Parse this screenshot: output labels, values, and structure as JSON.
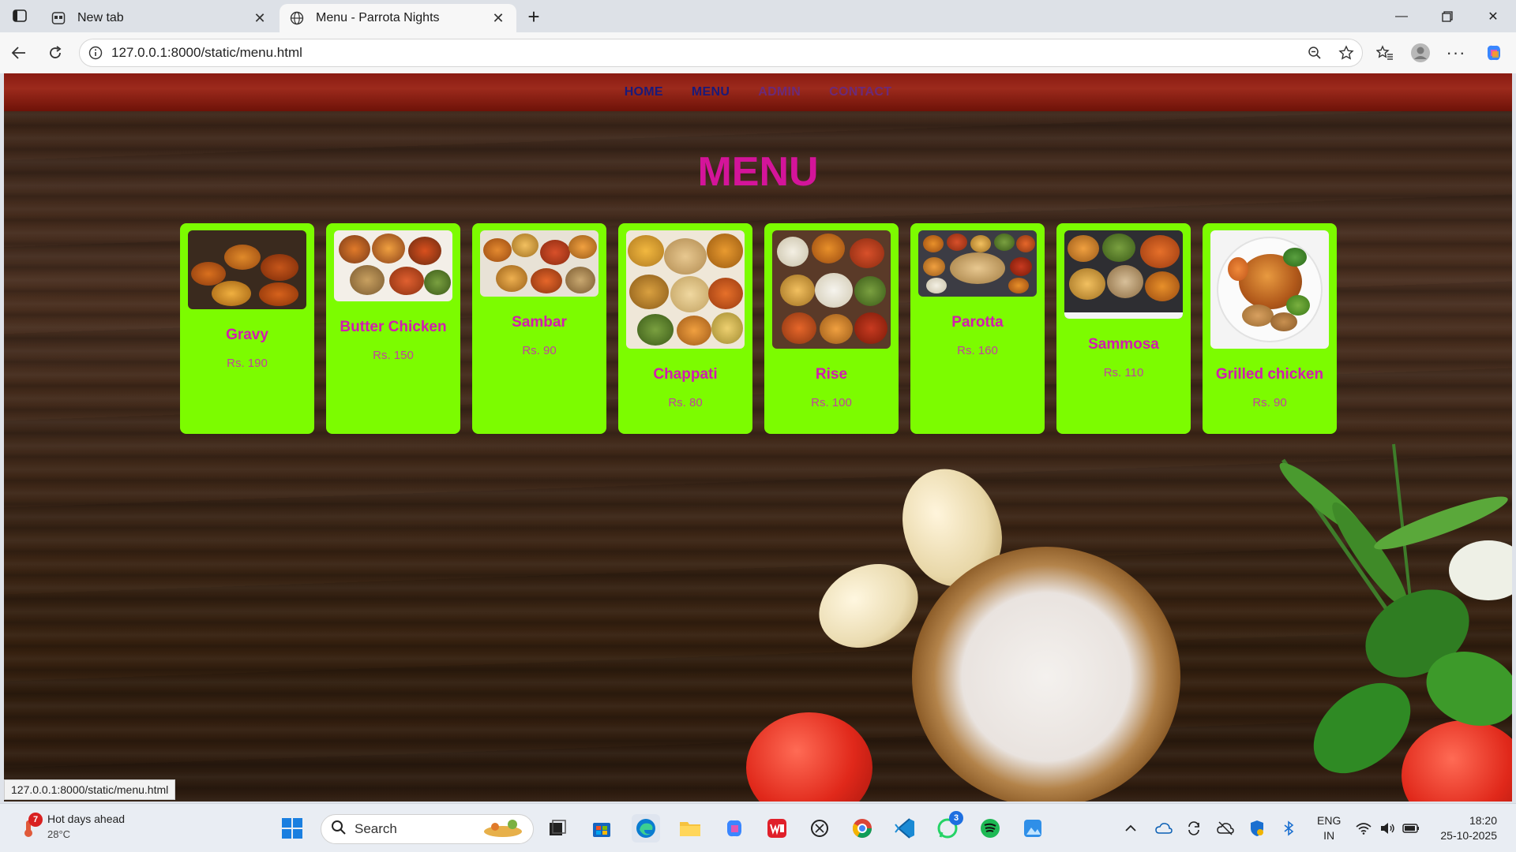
{
  "browser": {
    "tabs": [
      {
        "title": "New tab",
        "active": false
      },
      {
        "title": "Menu - Parrota Nights",
        "active": true
      }
    ],
    "url": "127.0.0.1:8000/static/menu.html",
    "status_url": "127.0.0.1:8000/static/menu.html"
  },
  "page": {
    "nav": {
      "home": "HOME",
      "menu": "MENU",
      "admin": "ADMIN",
      "contact": "CONTACT"
    },
    "title": "MENU",
    "items": [
      {
        "name": "Gravy",
        "price": "Rs. 190"
      },
      {
        "name": "Butter Chicken",
        "price": "Rs. 150"
      },
      {
        "name": "Sambar",
        "price": "Rs. 90"
      },
      {
        "name": "Chappati",
        "price": "Rs. 80"
      },
      {
        "name": "Rise",
        "price": "Rs. 100"
      },
      {
        "name": "Parotta",
        "price": "Rs. 160"
      },
      {
        "name": "Sammosa",
        "price": "Rs. 110"
      },
      {
        "name": "Grilled chicken",
        "price": "Rs. 90"
      }
    ],
    "colors": {
      "card_bg": "#7cfc00",
      "title": "#d4149a",
      "item_name": "#d21bb0",
      "nav_bg": "#8a1b12"
    }
  },
  "taskbar": {
    "weather_badge": "7",
    "weather_title": "Hot days ahead",
    "weather_temp": "28°C",
    "search_placeholder": "Search",
    "whatsapp_badge": "3",
    "lang_line1": "ENG",
    "lang_line2": "IN",
    "time": "18:20",
    "date": "25-10-2025"
  }
}
